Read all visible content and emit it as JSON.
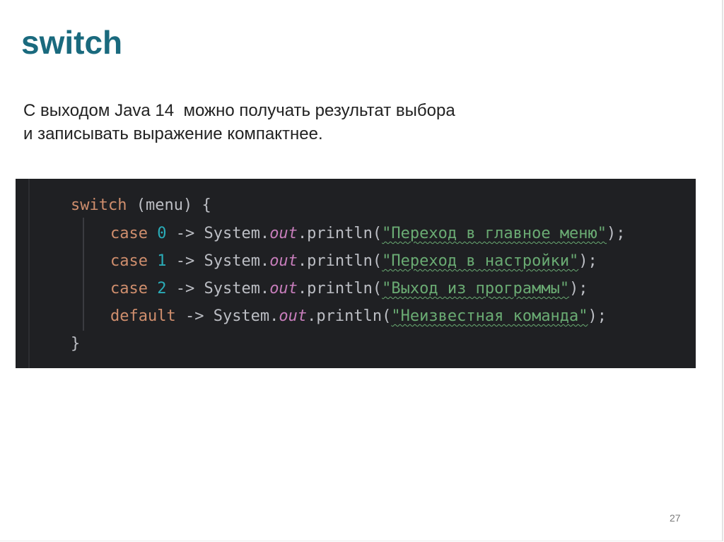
{
  "slide": {
    "title": "switch",
    "body_lines": [
      "С выходом Java 14  можно получать результат выбора",
      "и записывать выражение компактнее."
    ],
    "page_number": "27"
  },
  "code": {
    "header": {
      "keyword": "switch",
      "rest": " (menu) {"
    },
    "cases": [
      {
        "keyword": "case",
        "value": "0",
        "arrow": " -> System.",
        "field": "out",
        "call": ".println(",
        "string": "\"Переход в главное меню\"",
        "end": ");"
      },
      {
        "keyword": "case",
        "value": "1",
        "arrow": " -> System.",
        "field": "out",
        "call": ".println(",
        "string": "\"Переход в настройки\"",
        "end": ");"
      },
      {
        "keyword": "case",
        "value": "2",
        "arrow": " -> System.",
        "field": "out",
        "call": ".println(",
        "string": "\"Выход из программы\"",
        "end": ");"
      }
    ],
    "default": {
      "keyword": "default",
      "arrow": " -> System.",
      "field": "out",
      "call": ".println(",
      "string": "\"Неизвестная команда\"",
      "end": ");"
    },
    "closing": "}"
  },
  "colors": {
    "title": "#1a6a7e",
    "code_background": "#1f2023",
    "keyword": "#cf8e6d",
    "number": "#2aacb8",
    "field": "#c77dbb",
    "string": "#6aab73",
    "plain": "#bcbec4"
  }
}
